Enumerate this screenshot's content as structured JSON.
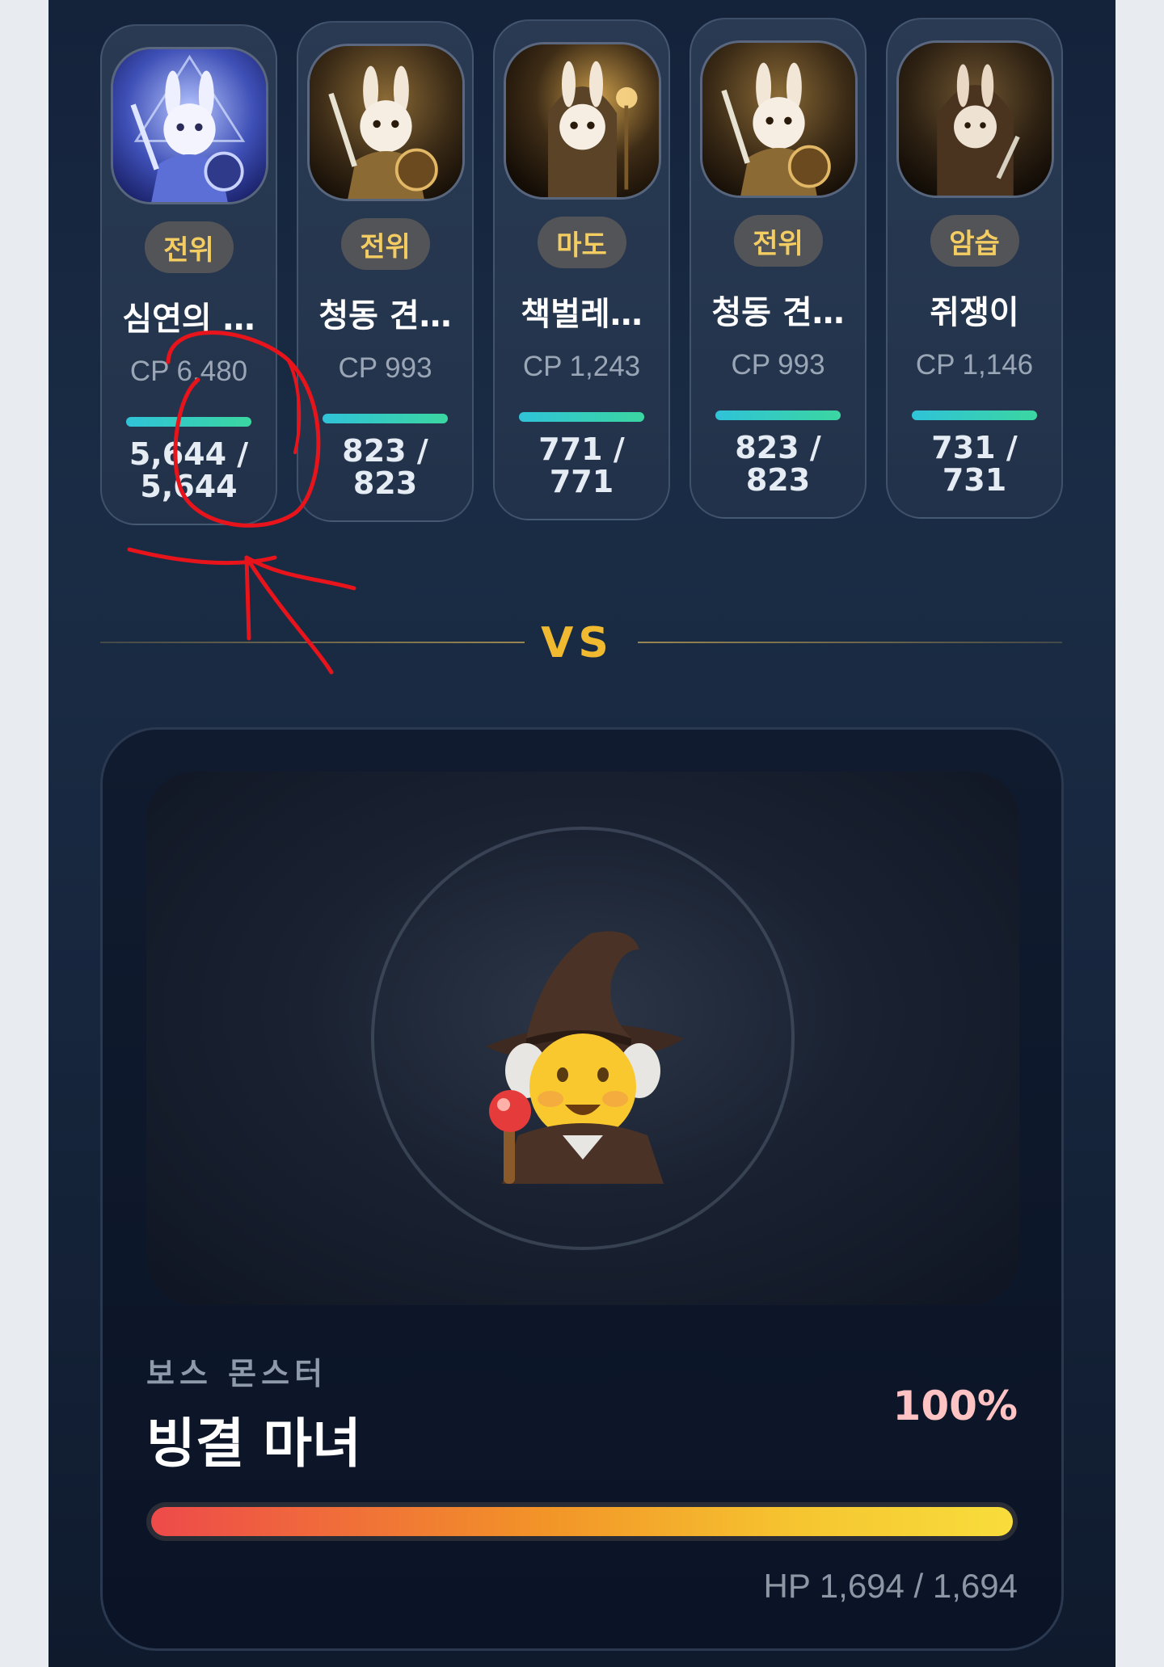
{
  "party": [
    {
      "role": "전위",
      "name": "심연의 …",
      "cp": "CP 6,480",
      "hp_cur": "5,644 /",
      "hp_max": "5,644",
      "hp_fraction": 1.0,
      "theme": "blue"
    },
    {
      "role": "전위",
      "name": "청동 견…",
      "cp": "CP 993",
      "hp_cur": "823 /",
      "hp_max": "823",
      "hp_fraction": 1.0,
      "theme": "gold"
    },
    {
      "role": "마도",
      "name": "책벌레…",
      "cp": "CP 1,243",
      "hp_cur": "771 /",
      "hp_max": "771",
      "hp_fraction": 1.0,
      "theme": "gold"
    },
    {
      "role": "전위",
      "name": "청동 견…",
      "cp": "CP 993",
      "hp_cur": "823 /",
      "hp_max": "823",
      "hp_fraction": 1.0,
      "theme": "gold"
    },
    {
      "role": "암습",
      "name": "쥐쟁이",
      "cp": "CP 1,146",
      "hp_cur": "731 /",
      "hp_max": "731",
      "hp_fraction": 1.0,
      "theme": "dark"
    }
  ],
  "versus": {
    "label": "VS"
  },
  "boss": {
    "label": "보스 몬스터",
    "name": "빙결 마녀",
    "percent": "100%",
    "hp_text": "HP 1,694 / 1,694",
    "hp_fraction": 1.0
  },
  "colors": {
    "accent_gold": "#f0b930",
    "role_text": "#f4cd62",
    "annotation_red": "#e8141c"
  }
}
